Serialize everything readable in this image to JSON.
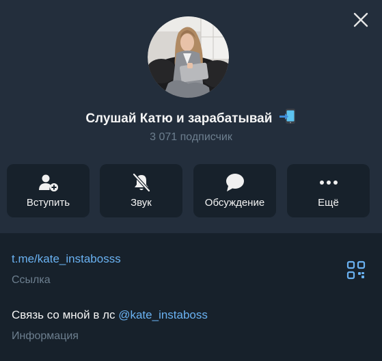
{
  "channel": {
    "title": "Слушай Катю и зарабатывай",
    "title_emoji_icon": "mobile-phone-arrow-icon",
    "subscribers": "3 071 подписчик"
  },
  "actions": [
    {
      "label": "Вступить",
      "icon": "add-user-icon"
    },
    {
      "label": "Звук",
      "icon": "bell-muted-icon"
    },
    {
      "label": "Обсуждение",
      "icon": "chat-bubble-icon"
    },
    {
      "label": "Ещё",
      "icon": "more-dots-icon"
    }
  ],
  "info": {
    "link": "t.me/kate_instabosss",
    "link_caption": "Ссылка",
    "bio_text": "Связь со мной в лс ",
    "bio_mention": "@kate_instaboss",
    "bio_caption": "Информация"
  },
  "colors": {
    "header_bg": "#232e3c",
    "body_bg": "#17212b",
    "accent": "#6ab2f2",
    "muted": "#6d7f8f"
  }
}
